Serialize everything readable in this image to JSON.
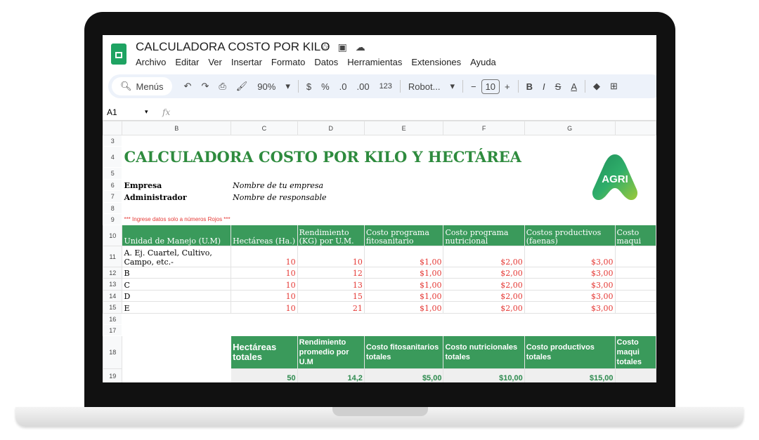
{
  "app": {
    "title": "CALCULADORA COSTO POR KILO",
    "menu": [
      "Archivo",
      "Editar",
      "Ver",
      "Insertar",
      "Formato",
      "Datos",
      "Herramientas",
      "Extensiones",
      "Ayuda"
    ]
  },
  "toolbar": {
    "search": "Menús",
    "zoom": "90%",
    "currency": "$",
    "percent": "%",
    "dec_less": ".0",
    "dec_more": ".00",
    "format123": "123",
    "font": "Robot...",
    "font_size": "10"
  },
  "formula_bar": {
    "cell": "A1",
    "fx": "fx"
  },
  "columns": [
    "B",
    "C",
    "D",
    "E",
    "F",
    "G"
  ],
  "rows": [
    "3",
    "4",
    "5",
    "6",
    "7",
    "8",
    "9",
    "10",
    "11",
    "12",
    "13",
    "14",
    "15",
    "16",
    "17",
    "18",
    "19"
  ],
  "sheet": {
    "heading": "CALCULADORA COSTO POR KILO Y HECTÁREA",
    "empresa_label": "Empresa",
    "empresa_value": "Nombre de tu empresa",
    "admin_label": "Administrador",
    "admin_value": "Nombre de responsable",
    "note": "*** Ingrese datos solo a números Rojos ***",
    "logo_text": "AGRI",
    "headers": [
      "Unidad de Manejo (U.M)",
      "Hectáreas (Ha.)",
      "Rendimiento (KG) por U.M.",
      "Costo programa fitosanitario",
      "Costo programa nutricional",
      "Costos productivos (faenas)",
      "Costo maqui"
    ],
    "data": [
      [
        "A. Ej. Cuartel, Cultivo, Campo, etc.-",
        "10",
        "10",
        "$1,00",
        "$2,00",
        "$3,00"
      ],
      [
        "B",
        "10",
        "12",
        "$1,00",
        "$2,00",
        "$3,00"
      ],
      [
        "C",
        "10",
        "13",
        "$1,00",
        "$2,00",
        "$3,00"
      ],
      [
        "D",
        "10",
        "15",
        "$1,00",
        "$2,00",
        "$3,00"
      ],
      [
        "E",
        "10",
        "21",
        "$1,00",
        "$2,00",
        "$3,00"
      ]
    ],
    "totals_headers": [
      "Hectáreas totales",
      "Rendimiento promedio por U.M",
      "Costo fitosanitarios totales",
      "Costo nutricionales totales",
      "Costo productivos totales",
      "Costo maqui totales"
    ],
    "totals": [
      "50",
      "14,2",
      "$5,00",
      "$10,00",
      "$15,00"
    ]
  },
  "colors": {
    "green": "#3a9a5b",
    "red": "#e53935",
    "heading": "#2e8b3e"
  }
}
